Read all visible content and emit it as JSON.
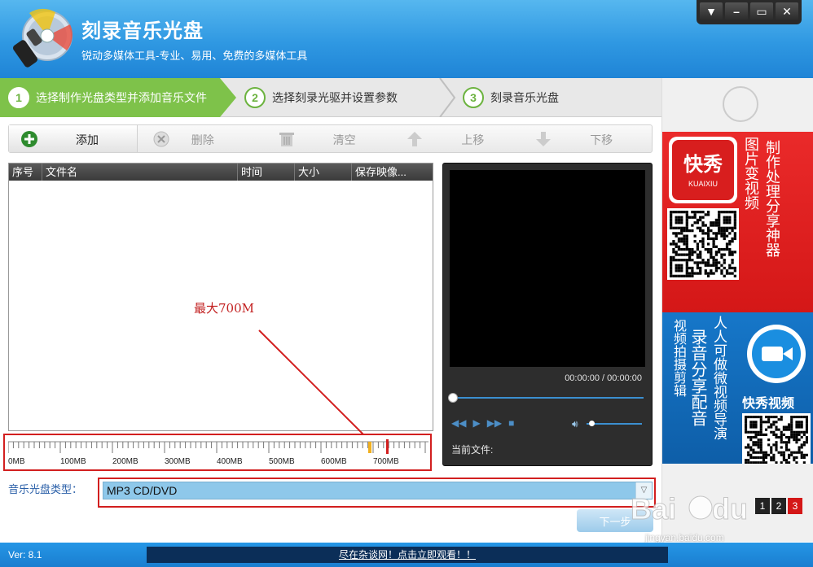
{
  "header": {
    "title": "刻录音乐光盘",
    "subtitle": "锐动多媒体工具-专业、易用、免费的多媒体工具",
    "window_controls": [
      "▼",
      "–",
      "▭",
      "✕"
    ]
  },
  "steps": [
    {
      "num": "1",
      "label": "选择制作光盘类型并添加音乐文件",
      "active": true
    },
    {
      "num": "2",
      "label": "选择刻录光驱并设置参数",
      "active": false
    },
    {
      "num": "3",
      "label": "刻录音乐光盘",
      "active": false
    }
  ],
  "toolbar": {
    "add": "添加",
    "delete": "删除",
    "clear": "清空",
    "move_up": "上移",
    "move_down": "下移"
  },
  "filelist": {
    "columns": [
      "序号",
      "文件名",
      "时间",
      "大小",
      "保存映像..."
    ]
  },
  "annotation": "最大700M",
  "sizebar": {
    "ticks": [
      "0MB",
      "100MB",
      "200MB",
      "300MB",
      "400MB",
      "500MB",
      "600MB",
      "700MB"
    ],
    "max_marker_mb": 700
  },
  "disc_type": {
    "label": "音乐光盘类型：",
    "value": "MP3 CD/DVD"
  },
  "player": {
    "time": "00:00:00 / 00:00:00",
    "current_file_label": "当前文件:",
    "seek_position": 0,
    "volume": 0.05
  },
  "ads": {
    "top_logo_cn": "快秀",
    "top_logo_en": "KUAIXIU",
    "top_text_1": "图片变视频",
    "top_text_2": "制作处理分享神器",
    "bottom_text_1": "视频拍摄剪辑",
    "bottom_text_2": "录音分享配音",
    "bottom_text_3": "人人可做微视频导演",
    "bottom_logo_text": "快秀视频",
    "pager": [
      "1",
      "2",
      "3"
    ],
    "pager_active": "3"
  },
  "next_button": "下一步",
  "watermark": "jingyan.baidu.com",
  "footer": {
    "version": "Ver: 8.1",
    "link": "尽在杂谈网！点击立即观看！！"
  },
  "colors": {
    "header_blue": "#2f98e2",
    "step_green": "#7ec24a",
    "highlight_red": "#d21f1f",
    "select_blue": "#8ec8ea"
  }
}
